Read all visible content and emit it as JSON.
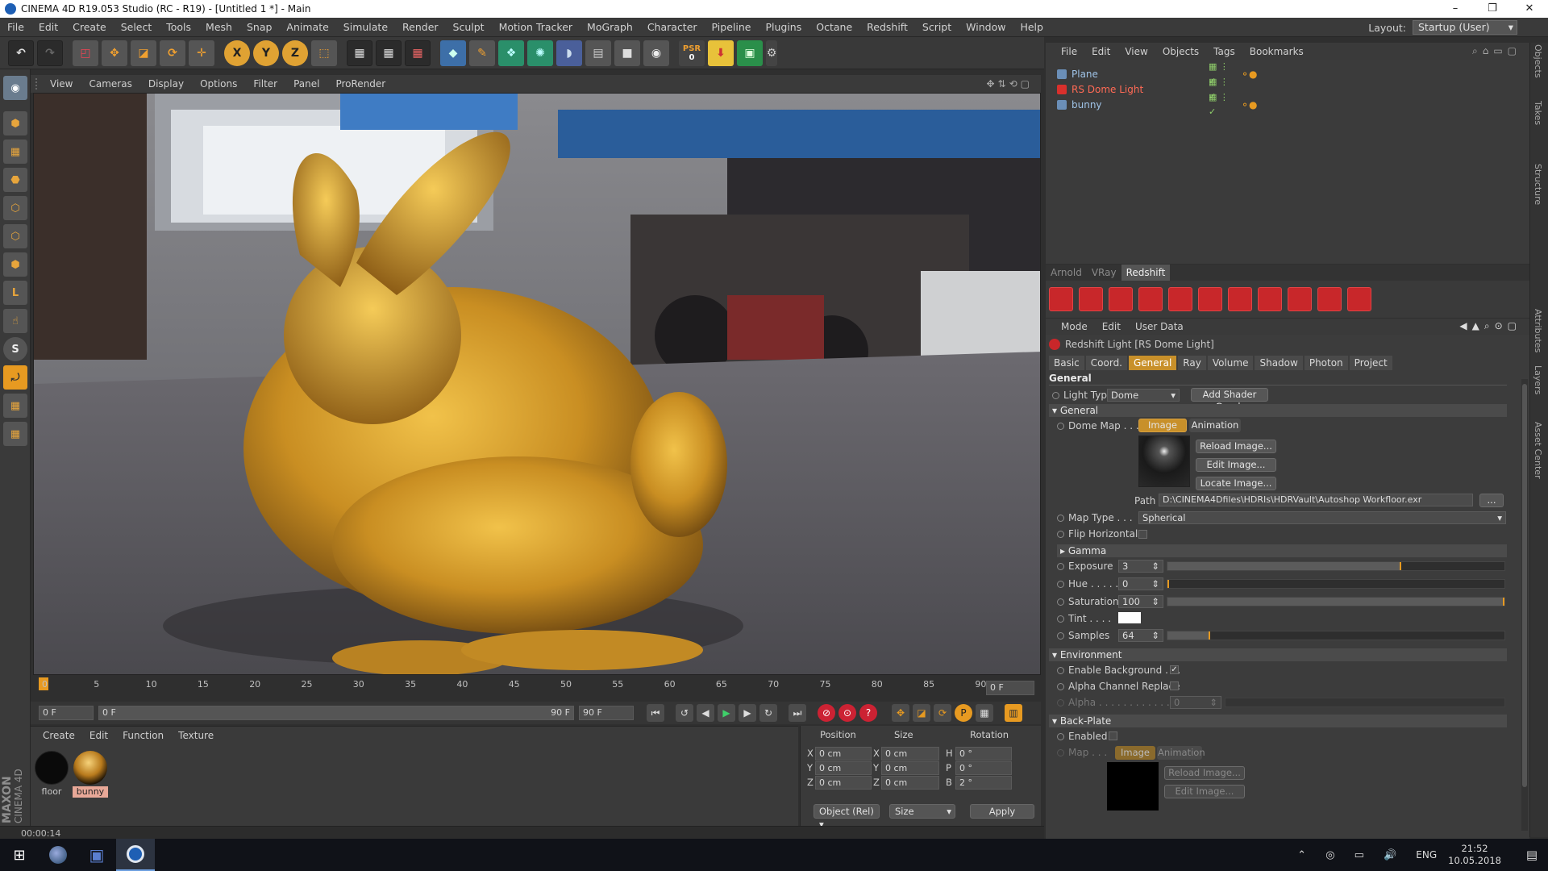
{
  "window": {
    "title": "CINEMA 4D R19.053 Studio (RC - R19) - [Untitled 1 *] - Main",
    "minimize": "–",
    "maximize": "❐",
    "close": "✕"
  },
  "menubar": {
    "items": [
      "File",
      "Edit",
      "Create",
      "Select",
      "Tools",
      "Mesh",
      "Snap",
      "Animate",
      "Simulate",
      "Render",
      "Sculpt",
      "Motion Tracker",
      "MoGraph",
      "Character",
      "Pipeline",
      "Plugins",
      "Octane",
      "Redshift",
      "Script",
      "Window",
      "Help"
    ]
  },
  "layout": {
    "label": "Layout:",
    "value": "Startup (User)"
  },
  "toolbar": {
    "axis_x": "X",
    "axis_y": "Y",
    "axis_z": "Z",
    "psr_label": "PSR",
    "psr_value": "0"
  },
  "viewport_menu": {
    "items": [
      "View",
      "Cameras",
      "Display",
      "Options",
      "Filter",
      "Panel",
      "ProRender"
    ]
  },
  "timeline": {
    "ticks": [
      "0",
      "5",
      "10",
      "15",
      "20",
      "25",
      "30",
      "35",
      "40",
      "45",
      "50",
      "55",
      "60",
      "65",
      "70",
      "75",
      "80",
      "85",
      "90"
    ],
    "current": "0 F"
  },
  "transport": {
    "start": "0 F",
    "range_start": "0 F",
    "range_end": "90 F",
    "end": "90 F"
  },
  "materials": {
    "menu": [
      "Create",
      "Edit",
      "Function",
      "Texture"
    ],
    "items": [
      {
        "name": "floor"
      },
      {
        "name": "bunny"
      }
    ]
  },
  "coordinates": {
    "headers": {
      "position": "Position",
      "size": "Size",
      "rotation": "Rotation"
    },
    "rows": [
      {
        "axis": "X",
        "pos": "0 cm",
        "saxis": "X",
        "size": "0 cm",
        "raxis": "H",
        "rot": "0 °"
      },
      {
        "axis": "Y",
        "pos": "0 cm",
        "saxis": "Y",
        "size": "0 cm",
        "raxis": "P",
        "rot": "0 °"
      },
      {
        "axis": "Z",
        "pos": "0 cm",
        "saxis": "Z",
        "size": "0 cm",
        "raxis": "B",
        "rot": "2 °"
      }
    ],
    "mode": "Object (Rel)",
    "size_mode": "Size",
    "apply": "Apply"
  },
  "status": {
    "time": "00:00:14"
  },
  "object_manager": {
    "menu": [
      "File",
      "Edit",
      "View",
      "Objects",
      "Tags",
      "Bookmarks"
    ],
    "objects": [
      {
        "name": "Plane",
        "color": "#9fc3e7"
      },
      {
        "name": "RS Dome Light",
        "color": "#ff6a55"
      },
      {
        "name": "bunny",
        "color": "#9fc3e7"
      }
    ]
  },
  "renderer_tabs": [
    "Arnold",
    "VRay",
    "Redshift"
  ],
  "attributes": {
    "menu": [
      "Mode",
      "Edit",
      "User Data"
    ],
    "title": "Redshift Light [RS Dome Light]",
    "tabs": [
      "Basic",
      "Coord.",
      "General",
      "Ray",
      "Volume",
      "Shadow",
      "Photon",
      "Project"
    ],
    "active_tab": "General",
    "section_general": "General",
    "light_type_label": "Light Type",
    "light_type": "Dome",
    "add_shader_graph": "Add Shader Graph",
    "sub_general": "General",
    "dome_map_label": "Dome Map . . .",
    "map_tab_image": "Image",
    "map_tab_animation": "Animation",
    "reload_image": "Reload Image...",
    "edit_image": "Edit Image...",
    "locate_image": "Locate Image...",
    "path_label": "Path",
    "path": "D:\\CINEMA4Dfiles\\HDRIs\\HDRVault\\Autoshop Workfloor.exr",
    "path_btn": "...",
    "map_type_label": "Map Type . . .",
    "map_type": "Spherical",
    "flip_horizontal_label": "Flip Horizontal",
    "gamma_label": "Gamma",
    "exposure_label": "Exposure",
    "exposure": "3",
    "hue_label": "Hue . . . . .",
    "hue": "0",
    "saturation_label": "Saturation",
    "saturation": "100",
    "tint_label": "Tint . . . .",
    "samples_label": "Samples",
    "samples": "64",
    "environment_label": "Environment",
    "enable_background_label": "Enable Background . . .",
    "enable_background_check": "✓",
    "alpha_channel_label": "Alpha Channel Replace",
    "alpha_label": "Alpha . . . . . . . . . . . .",
    "alpha": "0",
    "backplate_label": "Back-Plate",
    "bp_enabled_label": "Enabled",
    "bp_map_label": "Map . . .",
    "bp_image": "Image",
    "bp_animation": "Animation",
    "bp_reload": "Reload Image...",
    "bp_edit": "Edit Image..."
  },
  "side_tabs": [
    "Objects",
    "Takes",
    "Structure",
    "Attributes",
    "Layers",
    "Asset Center"
  ],
  "maxon": {
    "brand": "MAXON",
    "product": "CINEMA 4D"
  },
  "taskbar": {
    "lang": "ENG",
    "time": "21:52",
    "date": "10.05.2018"
  }
}
